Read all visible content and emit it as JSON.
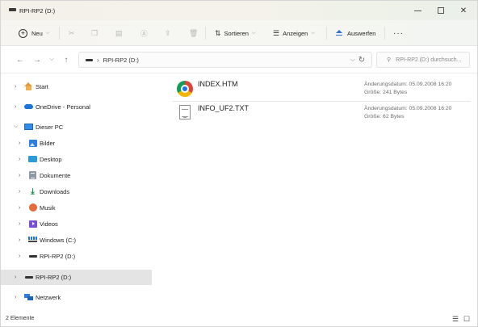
{
  "window": {
    "title": "RPI-RP2 (D:)"
  },
  "commandbar": {
    "new_label": "Neu",
    "sort_label": "Sortieren",
    "view_label": "Anzeigen",
    "eject_label": "Auswerfen",
    "more_label": "···"
  },
  "address": {
    "path": "RPI-RP2 (D:)",
    "search_placeholder": "RPI-RP2 (D:) durchsuch..."
  },
  "sidebar": {
    "items": [
      {
        "label": "Start",
        "icon": "home-icon"
      },
      {
        "label": "OneDrive - Personal",
        "icon": "cloud-icon"
      },
      {
        "label": "Dieser PC",
        "icon": "pc-icon"
      },
      {
        "label": "Bilder",
        "icon": "pictures-icon"
      },
      {
        "label": "Desktop",
        "icon": "desktop-icon"
      },
      {
        "label": "Dokumente",
        "icon": "documents-icon"
      },
      {
        "label": "Downloads",
        "icon": "downloads-icon"
      },
      {
        "label": "Musik",
        "icon": "music-icon"
      },
      {
        "label": "Videos",
        "icon": "videos-icon"
      },
      {
        "label": "Windows (C:)",
        "icon": "windows-drive-icon"
      },
      {
        "label": "RPI-RP2 (D:)",
        "icon": "drive-icon"
      },
      {
        "label": "RPI-RP2 (D:)",
        "icon": "drive-icon"
      },
      {
        "label": "Netzwerk",
        "icon": "network-icon"
      }
    ]
  },
  "files": [
    {
      "name": "INDEX.HTM",
      "icon": "chrome-icon",
      "modified": "Änderungsdatum: 05.09.2008 16:20",
      "size": "Größe: 241 Bytes"
    },
    {
      "name": "INFO_UF2.TXT",
      "icon": "text-file-icon",
      "modified": "Änderungsdatum: 05.09.2008 16:20",
      "size": "Größe: 62 Bytes"
    }
  ],
  "status": {
    "item_count": "2 Elemente"
  },
  "colors": {
    "accent": "#2f6fd6",
    "selected_bg": "#e4e4e4"
  }
}
